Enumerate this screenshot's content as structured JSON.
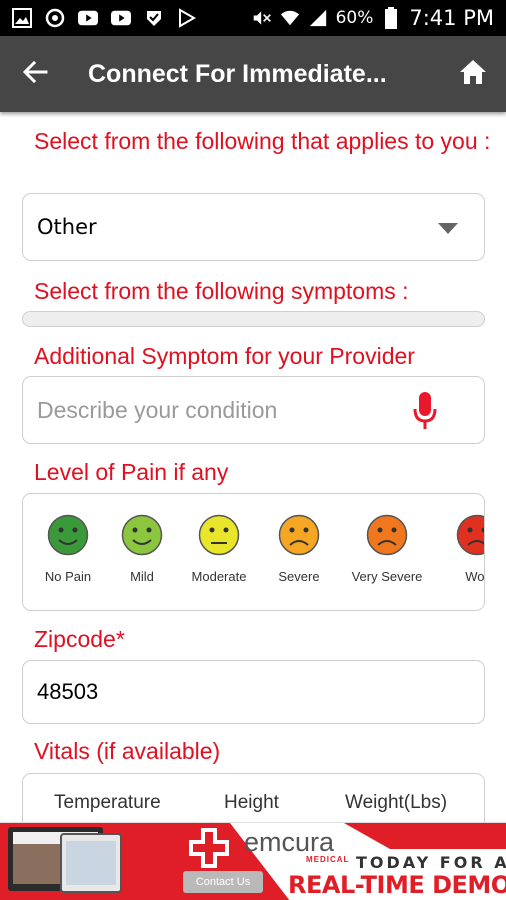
{
  "status_bar": {
    "battery": "60%",
    "time": "7:41 PM",
    "icons": [
      "gallery-icon",
      "sync-icon",
      "youtube-icon",
      "youtube-icon",
      "check-shield-icon",
      "play-store-icon",
      "mute-icon",
      "wifi-icon",
      "signal-icon",
      "battery-icon"
    ]
  },
  "app_bar": {
    "title": "Connect For Immediate...",
    "back_icon": "back-arrow-icon",
    "home_icon": "home-icon"
  },
  "form": {
    "applies_label": "Select from the following that applies to you :",
    "applies_value": "Other",
    "symptoms_label": "Select from the following symptoms :",
    "additional_label": "Additional Symptom for your Provider",
    "description_placeholder": "Describe your condition",
    "pain_label": "Level of Pain if any",
    "pain_levels": [
      {
        "label": "No Pain",
        "color": "#3a9a3a"
      },
      {
        "label": "Mild",
        "color": "#8cc63f"
      },
      {
        "label": "Moderate",
        "color": "#e8e52a"
      },
      {
        "label": "Severe",
        "color": "#f5a623"
      },
      {
        "label": "Very Severe",
        "color": "#f0771e"
      },
      {
        "label": "Wor",
        "color": "#e03020"
      }
    ],
    "zipcode_label": "Zipcode*",
    "zipcode_value": "48503",
    "vitals_label": "Vitals (if available)",
    "vitals_headers": [
      "Temperature",
      "Height",
      "Weight(Lbs)"
    ]
  },
  "banner": {
    "brand": "emcura",
    "brand_sub": "MEDICAL",
    "contact_button": "Contact Us",
    "tagline_top": "TODAY FOR A",
    "tagline_bottom": "REAL-TIME DEMO"
  },
  "colors": {
    "accent_red": "#e01020",
    "app_bar": "#464646"
  }
}
